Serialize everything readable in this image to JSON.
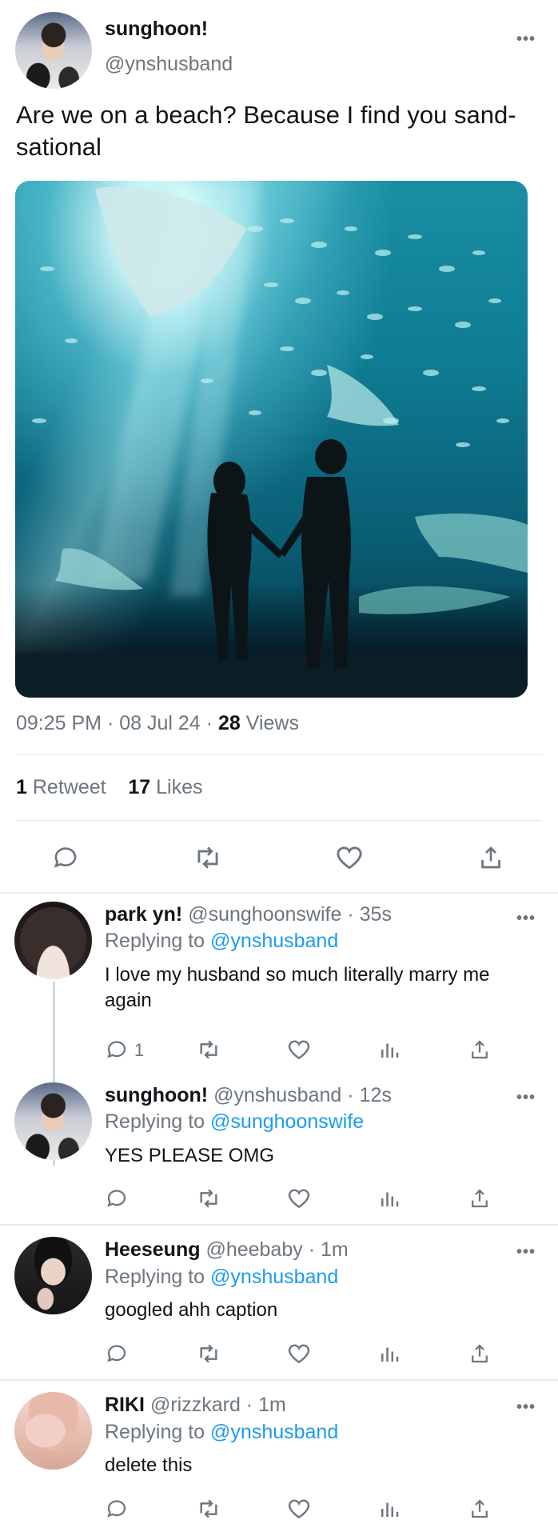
{
  "tweet": {
    "author_name": "sunghoon!",
    "author_handle": "@ynshusband",
    "text": "Are we on a beach? Because I find you sand-sational",
    "time": "09:25 PM",
    "date": "08 Jul 24",
    "views_count": "28",
    "views_label": "Views",
    "retweets_count": "1",
    "retweets_label": "Retweet",
    "likes_count": "17",
    "likes_label": "Likes"
  },
  "replies": [
    {
      "name": "park yn!",
      "handle": "@sunghoonswife",
      "time": "35s",
      "replying_prefix": "Replying to",
      "replying_to": "@ynshusband",
      "text": "I love my husband so much literally marry me again",
      "reply_count": "1"
    },
    {
      "name": "sunghoon!",
      "handle": "@ynshusband",
      "time": "12s",
      "replying_prefix": "Replying to",
      "replying_to": "@sunghoonswife",
      "text": "YES PLEASE OMG"
    },
    {
      "name": "Heeseung",
      "handle": "@heebaby",
      "time": "1m",
      "replying_prefix": "Replying to",
      "replying_to": "@ynshusband",
      "text": "googled ahh caption"
    },
    {
      "name": "RIKI",
      "handle": "@rizzkard",
      "time": "1m",
      "replying_prefix": "Replying to",
      "replying_to": "@ynshusband",
      "text": "delete this"
    }
  ],
  "ui": {
    "dot_sep": "·",
    "more_glyph": "•••",
    "link_color": "#1d9bf0",
    "muted_color": "#6c7680"
  }
}
